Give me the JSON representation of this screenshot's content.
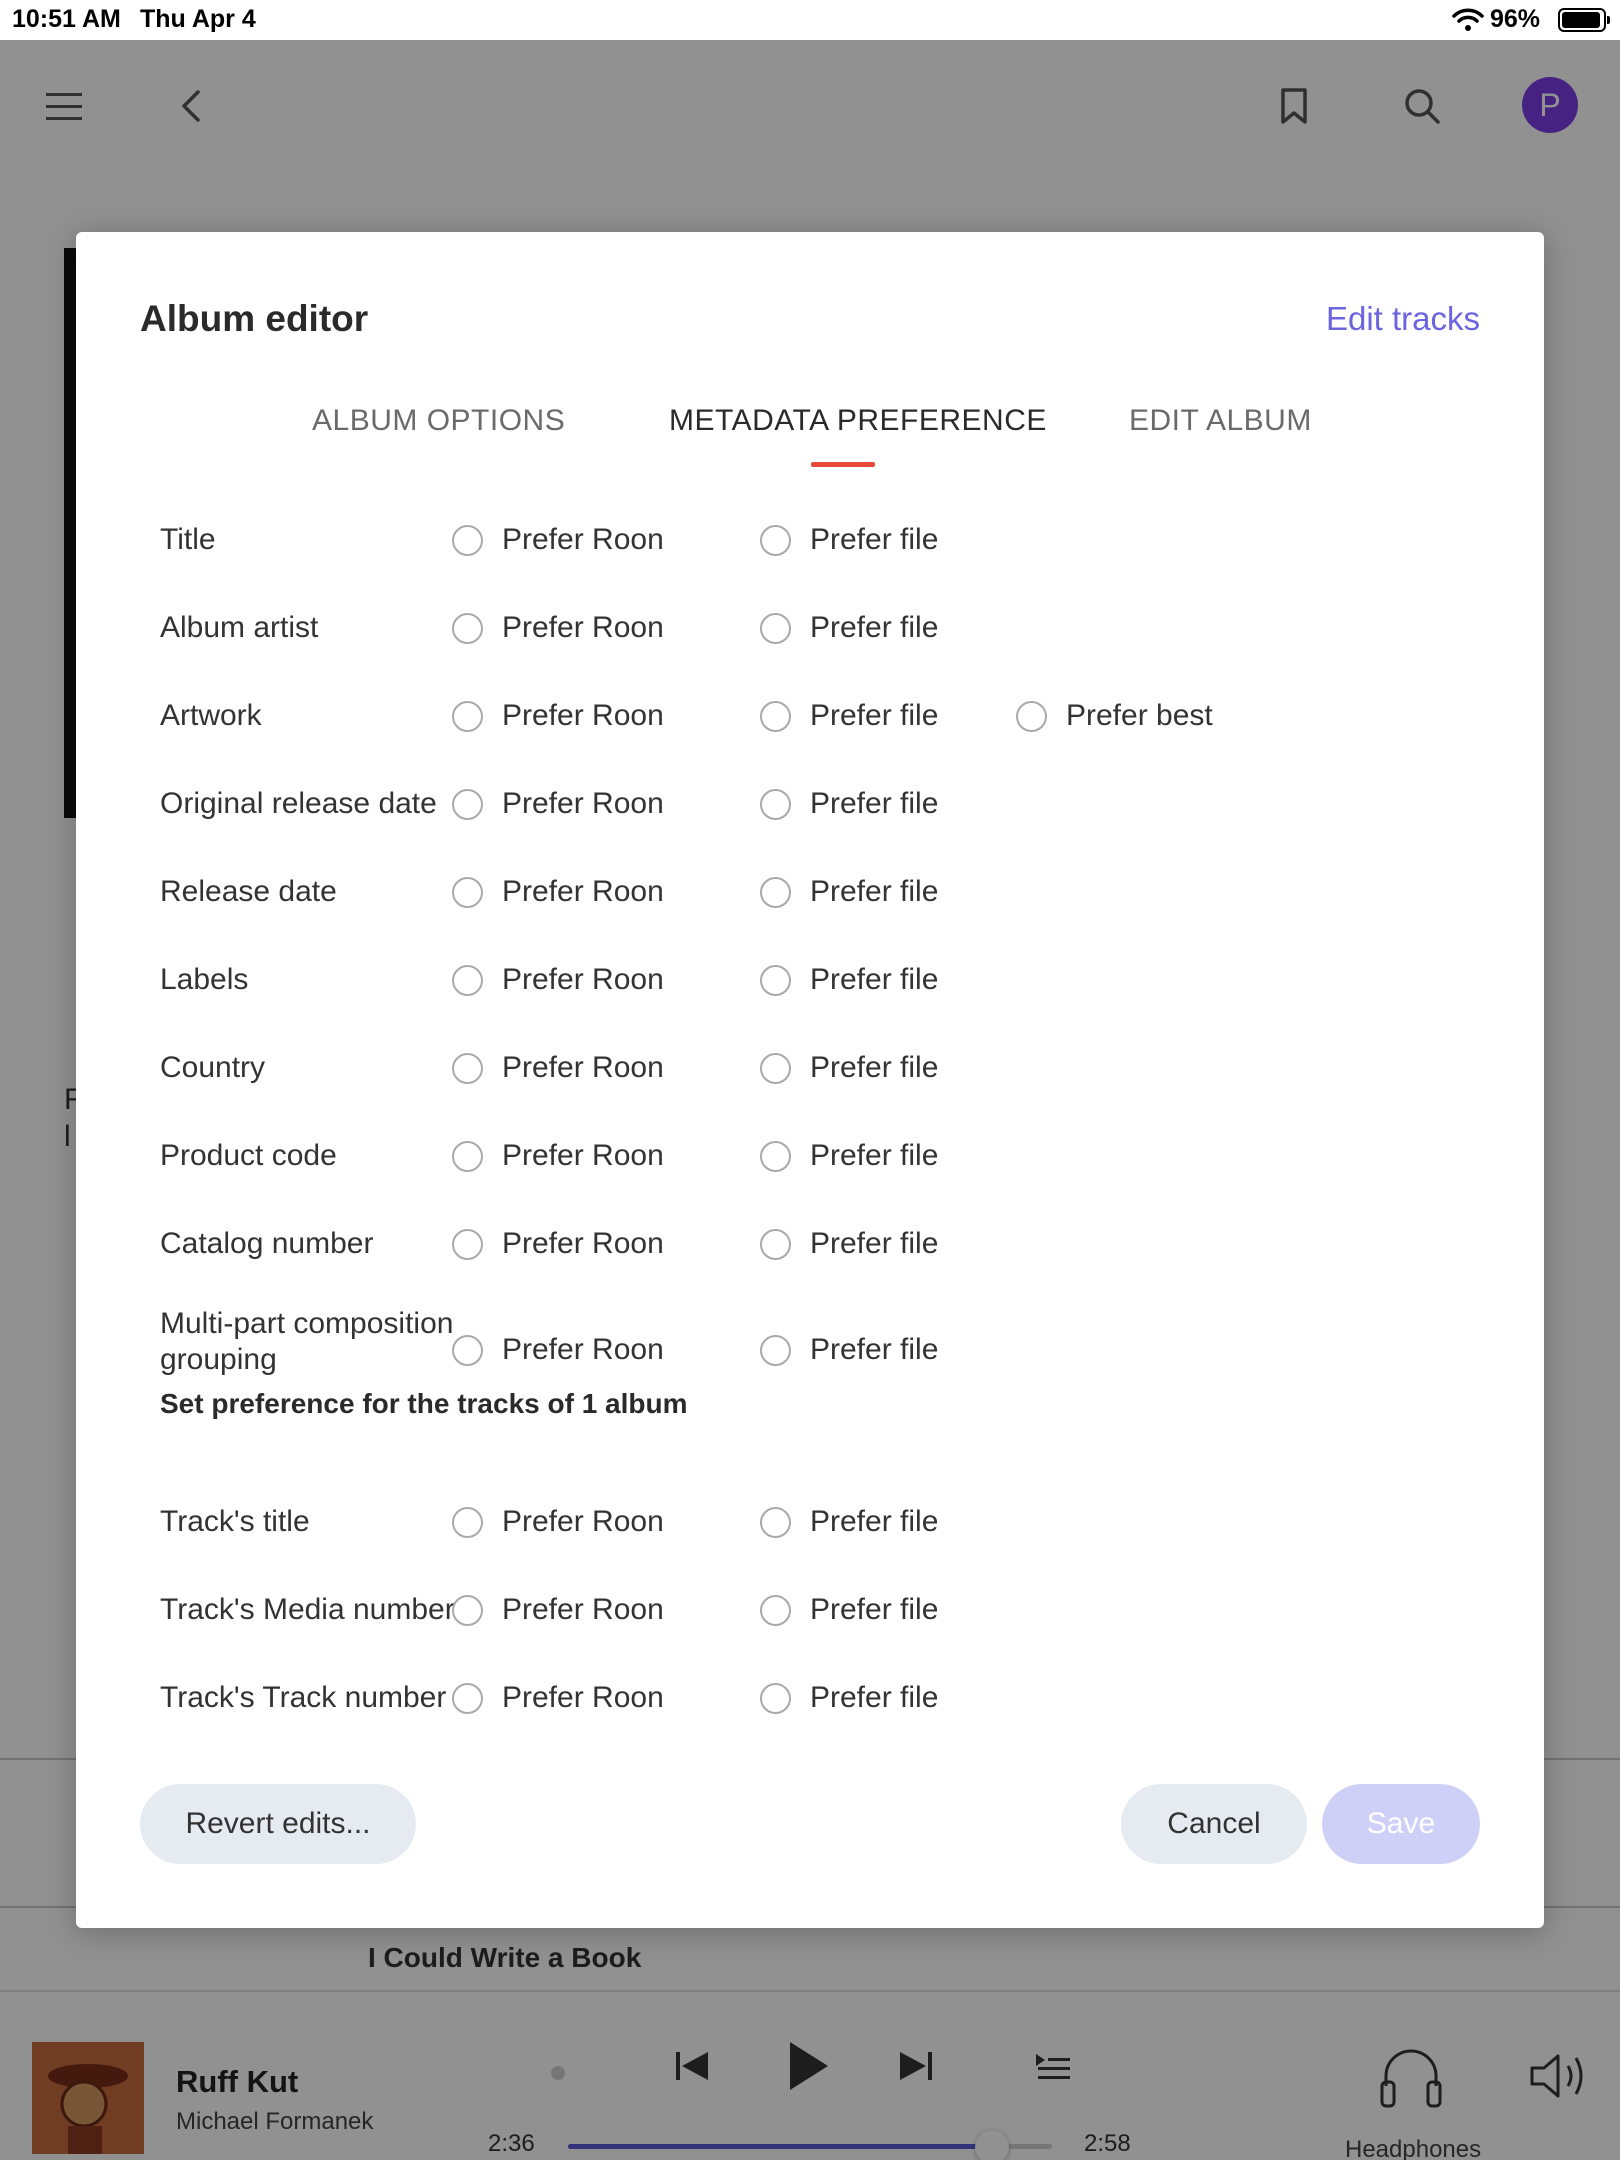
{
  "status_bar": {
    "time": "10:51 AM",
    "date": "Thu Apr 4",
    "battery": "96%",
    "battery_level": 0.96,
    "icons": [
      "wifi-icon",
      "battery-icon"
    ]
  },
  "app_header": {
    "avatar_initial": "P",
    "avatar_color": "#7b3fe4",
    "icons": [
      "menu-icon",
      "back-icon",
      "bookmark-icon",
      "search-icon"
    ]
  },
  "background": {
    "tracks_heading_fragment": "I Could Write a Book"
  },
  "modal": {
    "title": "Album editor",
    "edit_tracks_label": "Edit tracks",
    "accent_color": "#6c63e0",
    "tab_indicator_color": "#e8493b",
    "tabs": [
      {
        "label": "ALBUM OPTIONS",
        "active": false
      },
      {
        "label": "METADATA PREFERENCE",
        "active": true
      },
      {
        "label": "EDIT ALBUM",
        "active": false
      }
    ],
    "option_labels": {
      "roon": "Prefer Roon",
      "file": "Prefer file",
      "best": "Prefer best"
    },
    "album_fields": [
      {
        "label": "Title",
        "options": [
          "Prefer Roon",
          "Prefer file"
        ]
      },
      {
        "label": "Album artist",
        "options": [
          "Prefer Roon",
          "Prefer file"
        ]
      },
      {
        "label": "Artwork",
        "options": [
          "Prefer Roon",
          "Prefer file",
          "Prefer best"
        ]
      },
      {
        "label": "Original release date",
        "options": [
          "Prefer Roon",
          "Prefer file"
        ]
      },
      {
        "label": "Release date",
        "options": [
          "Prefer Roon",
          "Prefer file"
        ]
      },
      {
        "label": "Labels",
        "options": [
          "Prefer Roon",
          "Prefer file"
        ]
      },
      {
        "label": "Country",
        "options": [
          "Prefer Roon",
          "Prefer file"
        ]
      },
      {
        "label": "Product code",
        "options": [
          "Prefer Roon",
          "Prefer file"
        ]
      },
      {
        "label": "Catalog number",
        "options": [
          "Prefer Roon",
          "Prefer file"
        ]
      },
      {
        "label": "Multi-part composition grouping",
        "options": [
          "Prefer Roon",
          "Prefer file"
        ]
      }
    ],
    "track_section_heading": "Set preference for the tracks of 1 album",
    "track_fields": [
      {
        "label": "Track's title",
        "options": [
          "Prefer Roon",
          "Prefer file"
        ]
      },
      {
        "label": "Track's Media number",
        "options": [
          "Prefer Roon",
          "Prefer file"
        ]
      },
      {
        "label": "Track's Track number",
        "options": [
          "Prefer Roon",
          "Prefer file"
        ]
      }
    ],
    "buttons": {
      "revert": "Revert edits...",
      "cancel": "Cancel",
      "save": "Save"
    }
  },
  "now_playing": {
    "title": "Ruff Kut",
    "artist": "Michael Formanek",
    "elapsed": "2:36",
    "duration": "2:58",
    "progress": 0.876,
    "progress_color": "#5b58d6",
    "zone": "Headphones",
    "icons": [
      "previous-icon",
      "play-icon",
      "next-icon",
      "queue-icon",
      "headphones-icon",
      "volume-icon"
    ]
  }
}
